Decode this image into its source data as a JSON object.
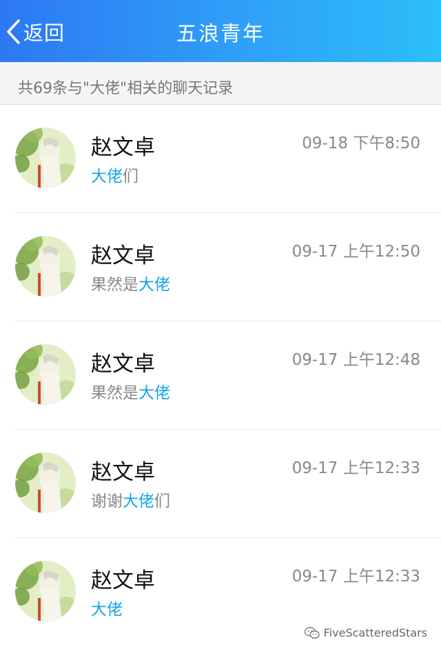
{
  "header": {
    "back_label": "返回",
    "title": "五浪青年"
  },
  "summary": {
    "text": "共69条与\"大佬\"相关的聊天记录"
  },
  "results": [
    {
      "name": "赵文卓",
      "pre": "",
      "highlight": "大佬",
      "post": "们",
      "time": "09-18 下午8:50"
    },
    {
      "name": "赵文卓",
      "pre": "果然是",
      "highlight": "大佬",
      "post": "",
      "time": "09-17 上午12:50"
    },
    {
      "name": "赵文卓",
      "pre": "果然是",
      "highlight": "大佬",
      "post": "",
      "time": "09-17 上午12:48"
    },
    {
      "name": "赵文卓",
      "pre": "谢谢",
      "highlight": "大佬",
      "post": "们",
      "time": "09-17 上午12:33"
    },
    {
      "name": "赵文卓",
      "pre": "",
      "highlight": "大佬",
      "post": "",
      "time": "09-17 上午12:33"
    }
  ],
  "watermark": {
    "text": "FiveScatteredStars"
  },
  "colors": {
    "header_gradient_start": "#2d78f4",
    "header_gradient_end": "#2bbff9",
    "highlight": "#13a4e6"
  }
}
